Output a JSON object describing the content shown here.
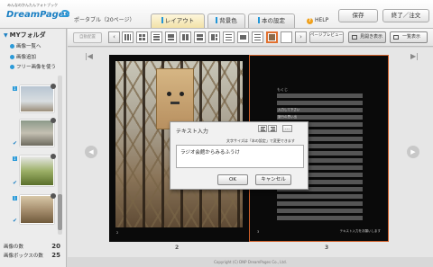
{
  "header": {
    "logo_tagline": "みんなのかんたんフォトブック",
    "logo_text": "DreamPages",
    "doc_type": "ポータブル（20ページ）",
    "tabs": [
      {
        "label": "レイアウト",
        "active": true
      },
      {
        "label": "背景色",
        "active": false
      },
      {
        "label": "本の設定",
        "active": false
      }
    ],
    "help_label": "HELP",
    "save_label": "保存",
    "exit_label": "終了／注文"
  },
  "sidebar": {
    "title": "MYフォルダ",
    "items": [
      {
        "label": "画像一覧へ"
      },
      {
        "label": "画像追加"
      },
      {
        "label": "フリー画像を使う"
      }
    ],
    "thumb_numbers": [
      "1",
      "1",
      "1"
    ],
    "stats": [
      {
        "label": "画像の数",
        "value": "20"
      },
      {
        "label": "画像ボックスの数",
        "value": "25"
      }
    ]
  },
  "toolbar": {
    "auto_layout_label": "自動配置",
    "preview_label": "ページプレビュー",
    "spread_label": "見開き表示",
    "list_label": "一覧表示"
  },
  "canvas": {
    "page_numbers": [
      "2",
      "3"
    ],
    "left_folio": "2",
    "right_folio": "3",
    "right_footer_text": "テキスト入力をお願いします",
    "toc_title": "もくじ",
    "toc_items": [
      "入力して下さい",
      "旅行の思い出",
      "春休み",
      "テキスト"
    ]
  },
  "dialog": {
    "title": "テキスト入力",
    "more_label": "…",
    "hint": "文字サイズは「本の設定」で変更できます",
    "text_value": "ラジオ会館からみるふうけ",
    "ok_label": "OK",
    "cancel_label": "キャンセル"
  },
  "footer": {
    "copyright": "Copyright (C) DNP DreamPages Co., Ltd."
  },
  "colors": {
    "accent_blue": "#2196d8",
    "selection_orange": "#e07030",
    "help_orange": "#f0a11d"
  }
}
